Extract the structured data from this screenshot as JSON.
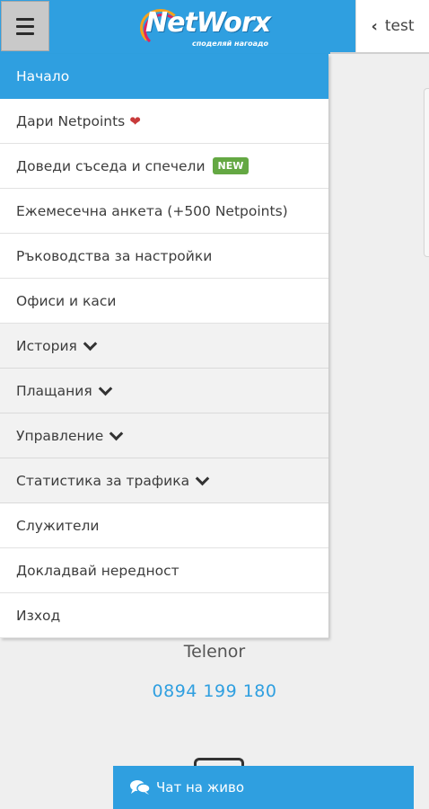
{
  "header": {
    "logo_text": "NetWorx",
    "logo_tagline": "споделяй нагоадо",
    "back_label": "test"
  },
  "menu": {
    "items": [
      {
        "label": "Начало",
        "active": true
      },
      {
        "label": "Дари Netpoints"
      },
      {
        "label": "Доведи съседа и спечели",
        "badge": "NEW"
      },
      {
        "label": "Ежемесечна анкета (+500 Netpoints)"
      },
      {
        "label": "Ръководства за настройки"
      },
      {
        "label": "Офиси и каси"
      },
      {
        "label": "История",
        "dropdown": true
      },
      {
        "label": "Плащания",
        "dropdown": true
      },
      {
        "label": "Управление",
        "dropdown": true
      },
      {
        "label": "Статистика за трафика",
        "dropdown": true
      },
      {
        "label": "Служители"
      },
      {
        "label": "Докладвай нередност"
      },
      {
        "label": "Изход"
      }
    ]
  },
  "contact": {
    "operator": "Telenor",
    "phone": "0894 199 180"
  },
  "chat": {
    "label": "Чат на живо"
  },
  "colors": {
    "accent": "#2f9fe0",
    "badge_new": "#64a843",
    "heart": "#c83a3a"
  }
}
